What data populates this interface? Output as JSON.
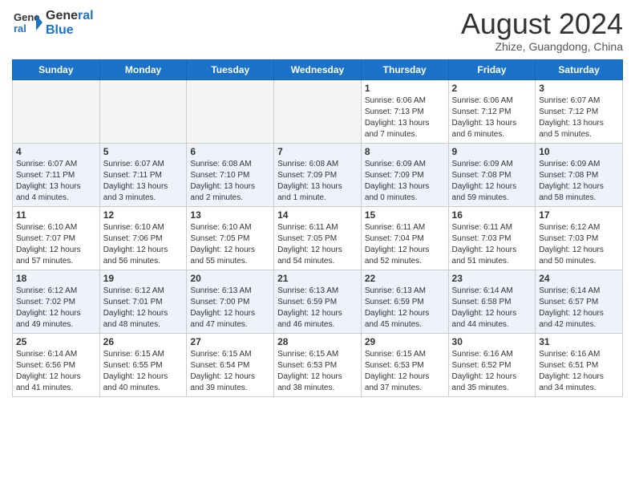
{
  "header": {
    "logo_line1": "General",
    "logo_line2": "Blue",
    "month": "August 2024",
    "location": "Zhize, Guangdong, China"
  },
  "days_of_week": [
    "Sunday",
    "Monday",
    "Tuesday",
    "Wednesday",
    "Thursday",
    "Friday",
    "Saturday"
  ],
  "weeks": [
    [
      {
        "num": "",
        "info": "",
        "empty": true
      },
      {
        "num": "",
        "info": "",
        "empty": true
      },
      {
        "num": "",
        "info": "",
        "empty": true
      },
      {
        "num": "",
        "info": "",
        "empty": true
      },
      {
        "num": "1",
        "info": "Sunrise: 6:06 AM\nSunset: 7:13 PM\nDaylight: 13 hours\nand 7 minutes."
      },
      {
        "num": "2",
        "info": "Sunrise: 6:06 AM\nSunset: 7:12 PM\nDaylight: 13 hours\nand 6 minutes."
      },
      {
        "num": "3",
        "info": "Sunrise: 6:07 AM\nSunset: 7:12 PM\nDaylight: 13 hours\nand 5 minutes."
      }
    ],
    [
      {
        "num": "4",
        "info": "Sunrise: 6:07 AM\nSunset: 7:11 PM\nDaylight: 13 hours\nand 4 minutes."
      },
      {
        "num": "5",
        "info": "Sunrise: 6:07 AM\nSunset: 7:11 PM\nDaylight: 13 hours\nand 3 minutes."
      },
      {
        "num": "6",
        "info": "Sunrise: 6:08 AM\nSunset: 7:10 PM\nDaylight: 13 hours\nand 2 minutes."
      },
      {
        "num": "7",
        "info": "Sunrise: 6:08 AM\nSunset: 7:09 PM\nDaylight: 13 hours\nand 1 minute."
      },
      {
        "num": "8",
        "info": "Sunrise: 6:09 AM\nSunset: 7:09 PM\nDaylight: 13 hours\nand 0 minutes."
      },
      {
        "num": "9",
        "info": "Sunrise: 6:09 AM\nSunset: 7:08 PM\nDaylight: 12 hours\nand 59 minutes."
      },
      {
        "num": "10",
        "info": "Sunrise: 6:09 AM\nSunset: 7:08 PM\nDaylight: 12 hours\nand 58 minutes."
      }
    ],
    [
      {
        "num": "11",
        "info": "Sunrise: 6:10 AM\nSunset: 7:07 PM\nDaylight: 12 hours\nand 57 minutes."
      },
      {
        "num": "12",
        "info": "Sunrise: 6:10 AM\nSunset: 7:06 PM\nDaylight: 12 hours\nand 56 minutes."
      },
      {
        "num": "13",
        "info": "Sunrise: 6:10 AM\nSunset: 7:05 PM\nDaylight: 12 hours\nand 55 minutes."
      },
      {
        "num": "14",
        "info": "Sunrise: 6:11 AM\nSunset: 7:05 PM\nDaylight: 12 hours\nand 54 minutes."
      },
      {
        "num": "15",
        "info": "Sunrise: 6:11 AM\nSunset: 7:04 PM\nDaylight: 12 hours\nand 52 minutes."
      },
      {
        "num": "16",
        "info": "Sunrise: 6:11 AM\nSunset: 7:03 PM\nDaylight: 12 hours\nand 51 minutes."
      },
      {
        "num": "17",
        "info": "Sunrise: 6:12 AM\nSunset: 7:03 PM\nDaylight: 12 hours\nand 50 minutes."
      }
    ],
    [
      {
        "num": "18",
        "info": "Sunrise: 6:12 AM\nSunset: 7:02 PM\nDaylight: 12 hours\nand 49 minutes."
      },
      {
        "num": "19",
        "info": "Sunrise: 6:12 AM\nSunset: 7:01 PM\nDaylight: 12 hours\nand 48 minutes."
      },
      {
        "num": "20",
        "info": "Sunrise: 6:13 AM\nSunset: 7:00 PM\nDaylight: 12 hours\nand 47 minutes."
      },
      {
        "num": "21",
        "info": "Sunrise: 6:13 AM\nSunset: 6:59 PM\nDaylight: 12 hours\nand 46 minutes."
      },
      {
        "num": "22",
        "info": "Sunrise: 6:13 AM\nSunset: 6:59 PM\nDaylight: 12 hours\nand 45 minutes."
      },
      {
        "num": "23",
        "info": "Sunrise: 6:14 AM\nSunset: 6:58 PM\nDaylight: 12 hours\nand 44 minutes."
      },
      {
        "num": "24",
        "info": "Sunrise: 6:14 AM\nSunset: 6:57 PM\nDaylight: 12 hours\nand 42 minutes."
      }
    ],
    [
      {
        "num": "25",
        "info": "Sunrise: 6:14 AM\nSunset: 6:56 PM\nDaylight: 12 hours\nand 41 minutes."
      },
      {
        "num": "26",
        "info": "Sunrise: 6:15 AM\nSunset: 6:55 PM\nDaylight: 12 hours\nand 40 minutes."
      },
      {
        "num": "27",
        "info": "Sunrise: 6:15 AM\nSunset: 6:54 PM\nDaylight: 12 hours\nand 39 minutes."
      },
      {
        "num": "28",
        "info": "Sunrise: 6:15 AM\nSunset: 6:53 PM\nDaylight: 12 hours\nand 38 minutes."
      },
      {
        "num": "29",
        "info": "Sunrise: 6:15 AM\nSunset: 6:53 PM\nDaylight: 12 hours\nand 37 minutes."
      },
      {
        "num": "30",
        "info": "Sunrise: 6:16 AM\nSunset: 6:52 PM\nDaylight: 12 hours\nand 35 minutes."
      },
      {
        "num": "31",
        "info": "Sunrise: 6:16 AM\nSunset: 6:51 PM\nDaylight: 12 hours\nand 34 minutes."
      }
    ]
  ]
}
